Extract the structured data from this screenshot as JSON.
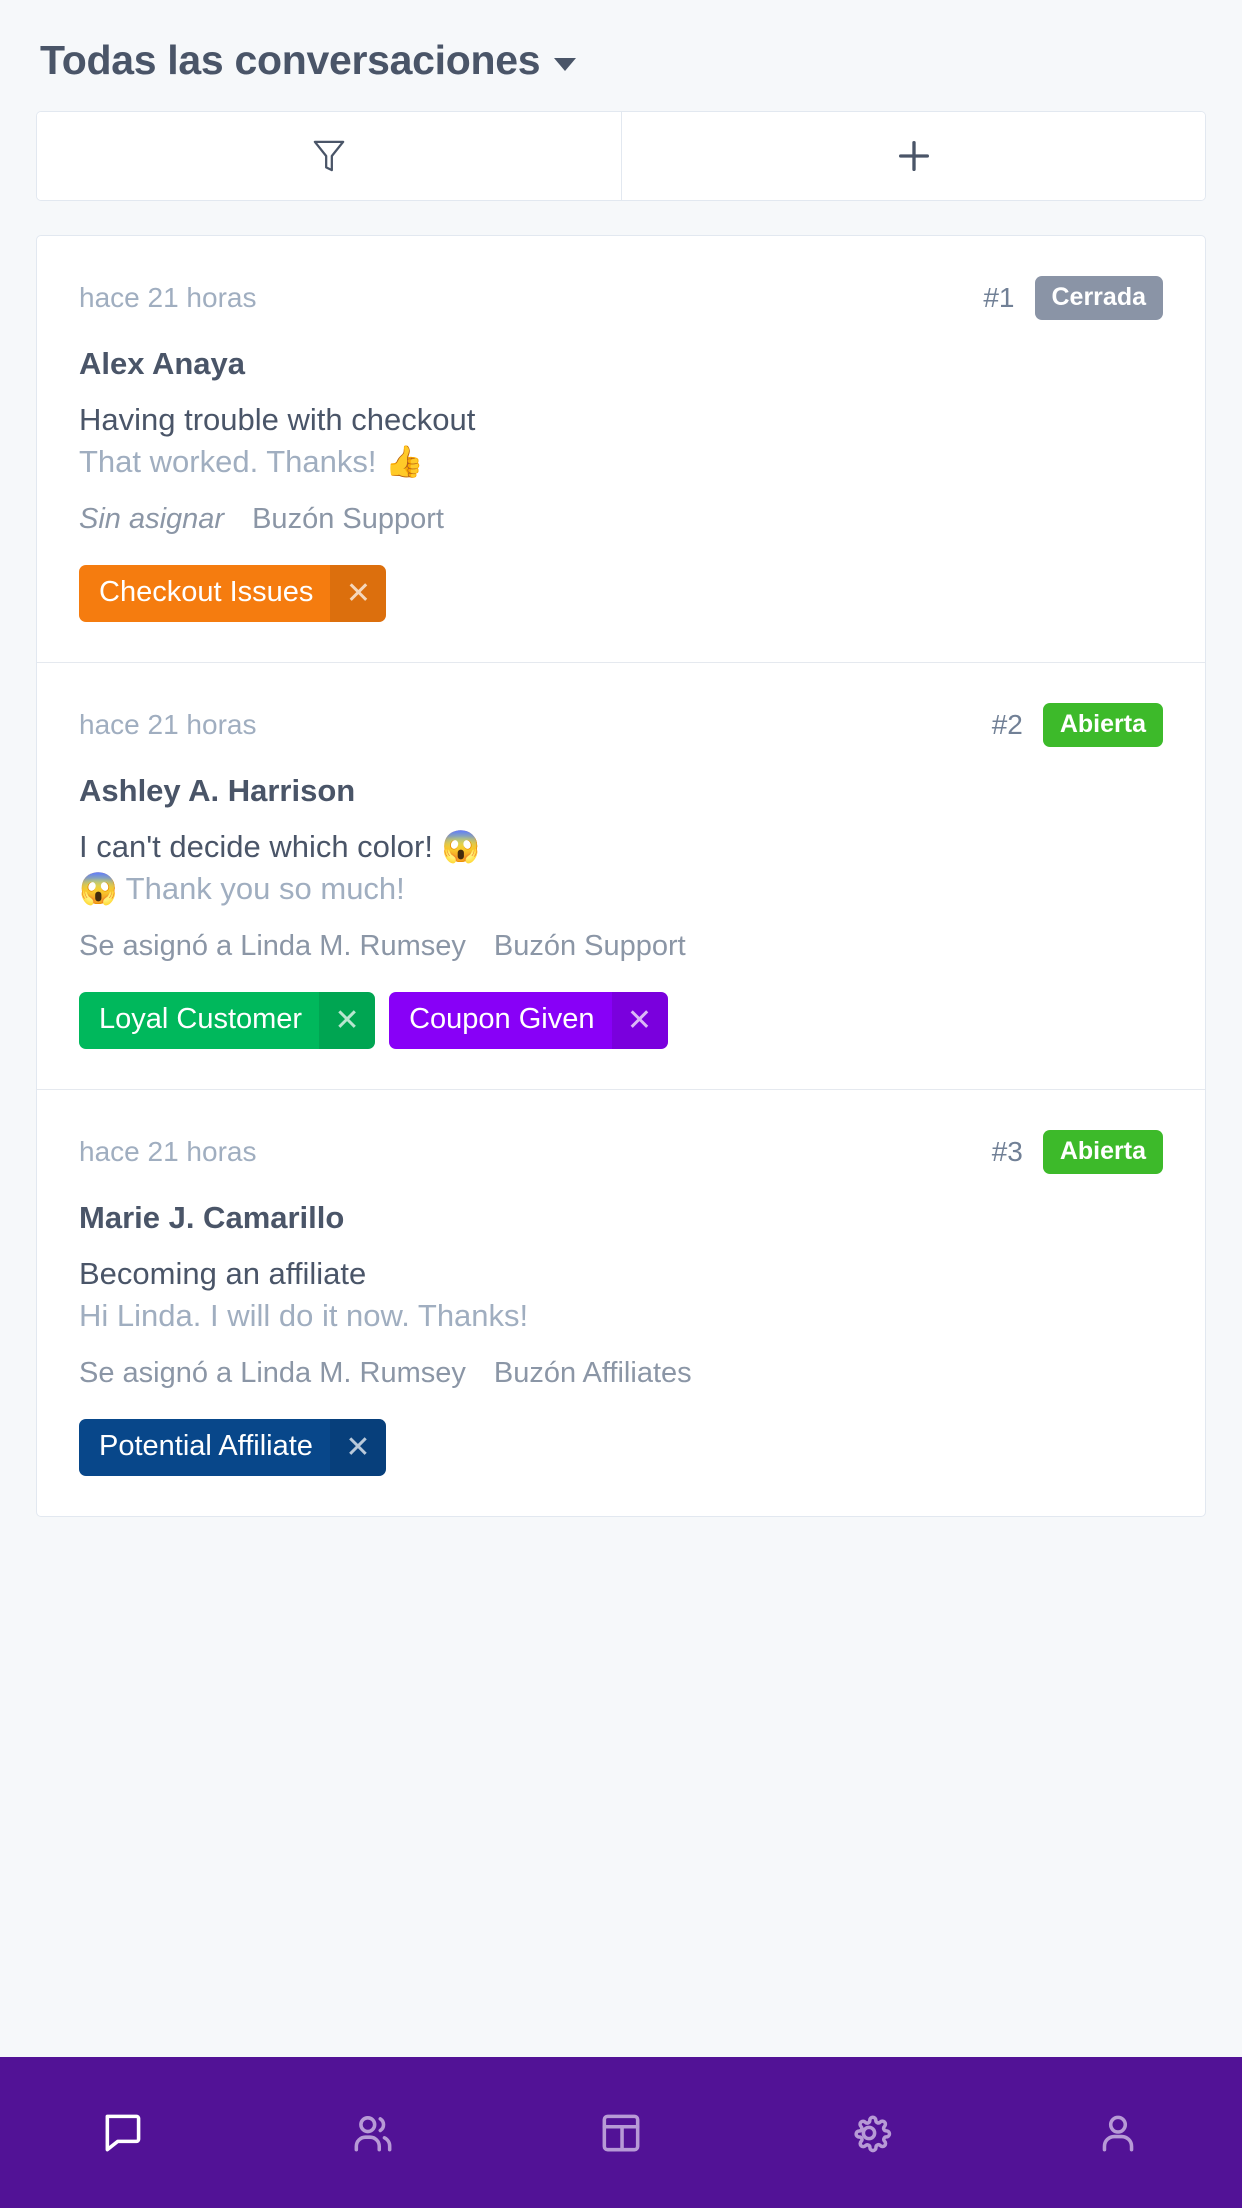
{
  "header": {
    "title": "Todas las conversaciones",
    "dropdown_icon": "chevron-down-icon"
  },
  "toolbar": {
    "filter_icon": "filter-icon",
    "add_icon": "plus-icon"
  },
  "conversations": [
    {
      "time": "hace 21 horas",
      "number": "#1",
      "status": "Cerrada",
      "status_type": "closed",
      "status_color": "#8a94a6",
      "name": "Alex Anaya",
      "subject": "Having trouble with checkout",
      "preview": "That worked. Thanks! 👍",
      "assignee": "Sin asignar",
      "assignee_italic": true,
      "mailbox": "Buzón Support",
      "tags": [
        {
          "label": "Checkout Issues",
          "color": "#f57c0f",
          "close_icon": "close-icon"
        }
      ]
    },
    {
      "time": "hace 21 horas",
      "number": "#2",
      "status": "Abierta",
      "status_type": "open",
      "status_color": "#3dba2a",
      "name": "Ashley A. Harrison",
      "subject": "I can't decide which color! 😱",
      "preview": "😱 Thank you so much!",
      "assignee": "Se asignó a Linda M. Rumsey",
      "assignee_italic": false,
      "mailbox": "Buzón Support",
      "tags": [
        {
          "label": "Loyal Customer",
          "color": "#00b85c",
          "close_icon": "close-icon"
        },
        {
          "label": "Coupon Given",
          "color": "#8800f7",
          "close_icon": "close-icon"
        }
      ]
    },
    {
      "time": "hace 21 horas",
      "number": "#3",
      "status": "Abierta",
      "status_type": "open",
      "status_color": "#3dba2a",
      "name": "Marie J. Camarillo",
      "subject": "Becoming an affiliate",
      "preview": "Hi Linda. I will do it now. Thanks!",
      "assignee": "Se asignó a Linda M. Rumsey",
      "assignee_italic": false,
      "mailbox": "Buzón Affiliates",
      "tags": [
        {
          "label": "Potential Affiliate",
          "color": "#08478a",
          "close_icon": "close-icon"
        }
      ]
    }
  ],
  "bottom_nav": {
    "background": "#521296",
    "items": [
      {
        "icon": "chat-icon",
        "active": true
      },
      {
        "icon": "users-icon",
        "active": false
      },
      {
        "icon": "dashboard-icon",
        "active": false
      },
      {
        "icon": "gear-icon",
        "active": false
      },
      {
        "icon": "person-icon",
        "active": false
      }
    ]
  }
}
